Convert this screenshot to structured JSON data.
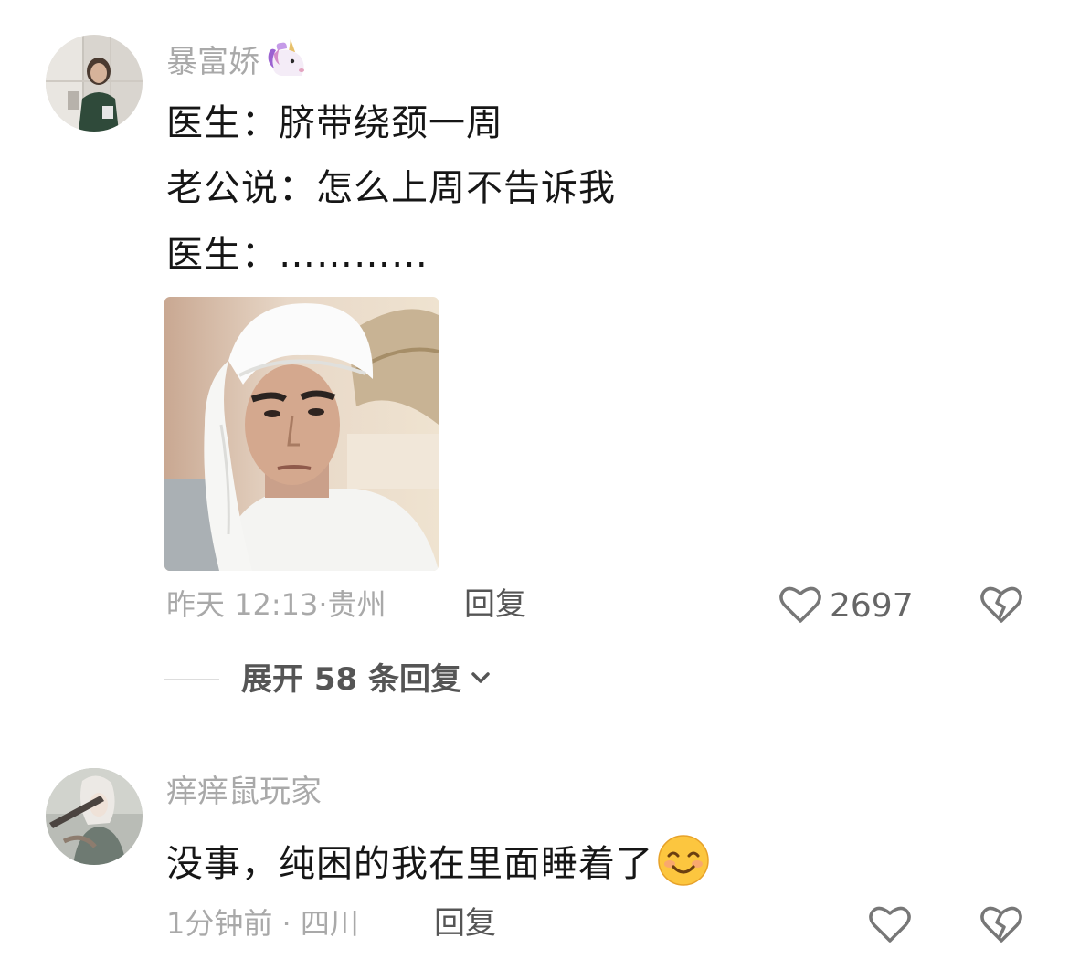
{
  "comments": [
    {
      "username": "暴富娇",
      "username_emoji": "unicorn-emoji",
      "lines": [
        "医生：脐带绕颈一周",
        "老公说：怎么上周不告诉我",
        "医生：…………"
      ],
      "time": "昨天 12:13",
      "location": "贵州",
      "reply_label": "回复",
      "likes": "2697"
    },
    {
      "username": "痒痒鼠玩家",
      "text": "没事，纯困的我在里面睡着了",
      "text_emoji": "smiling-face-emoji",
      "time": "1分钟前",
      "location": "四川",
      "reply_label": "回复"
    }
  ],
  "expand_replies": "展开 58 条回复",
  "icons": {
    "like": "heart-outline-icon",
    "dislike": "broken-heart-icon",
    "expand": "chevron-down-icon"
  },
  "colors": {
    "username": "#a9a9a9",
    "text": "#161616",
    "meta": "#a9a9a9",
    "action": "#555555"
  }
}
